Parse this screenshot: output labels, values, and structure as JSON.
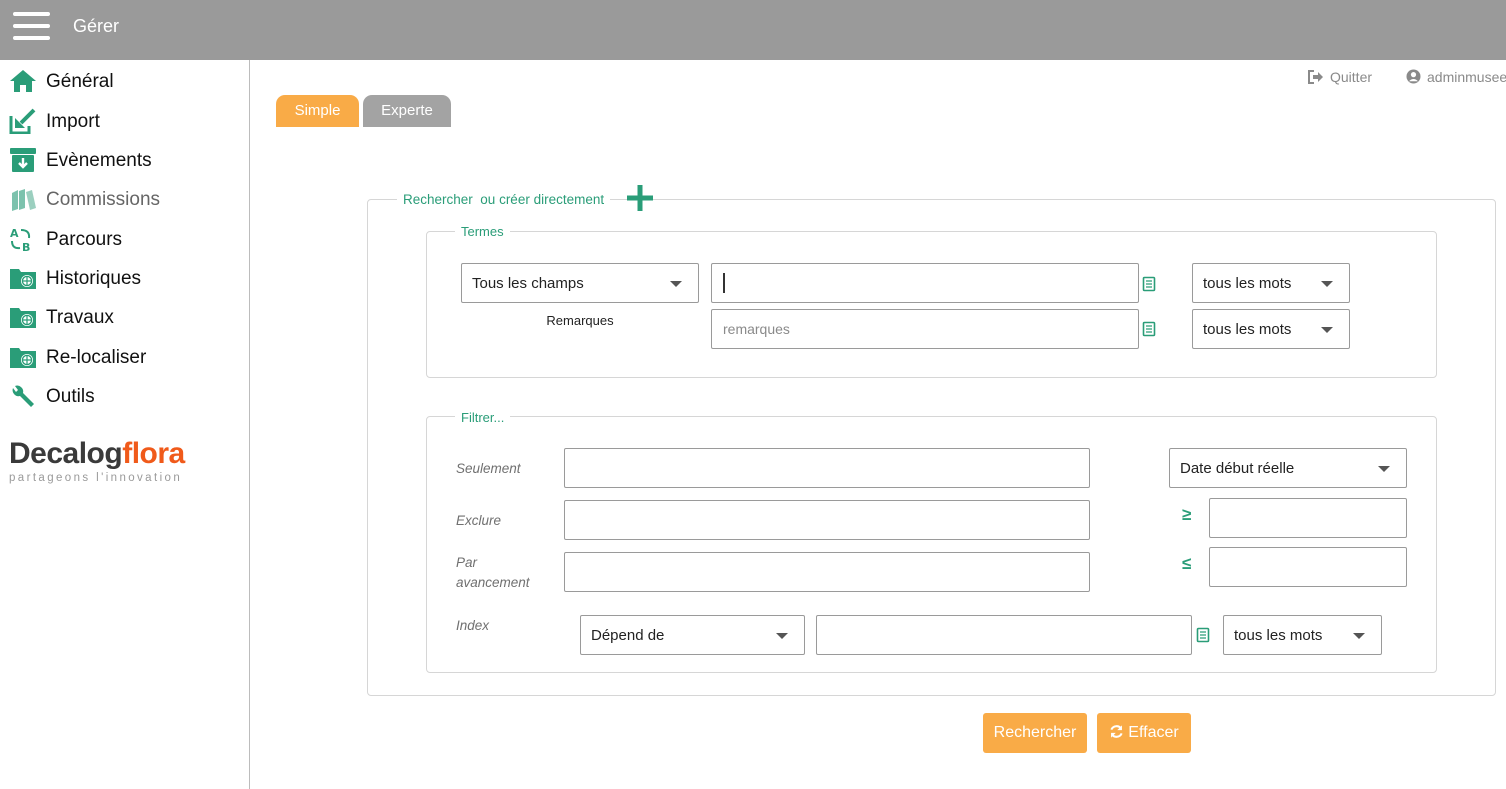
{
  "header": {
    "title": "Gérer",
    "menu_icon": "hamburger-icon"
  },
  "sidebar": {
    "items": [
      {
        "label": "Général",
        "icon": "home-icon"
      },
      {
        "label": "Import",
        "icon": "import-icon"
      },
      {
        "label": "Evènements",
        "icon": "archive-download-icon"
      },
      {
        "label": "Commissions",
        "icon": "books-icon"
      },
      {
        "label": "Parcours",
        "icon": "route-icon"
      },
      {
        "label": "Historiques",
        "icon": "folder-globe-icon"
      },
      {
        "label": "Travaux",
        "icon": "folder-globe-icon"
      },
      {
        "label": "Re-localiser",
        "icon": "folder-globe-icon"
      },
      {
        "label": "Outils",
        "icon": "wrench-icon"
      }
    ],
    "logo": {
      "part1": "Decalog",
      "part2": "flora",
      "tagline": "partageons l'innovation"
    }
  },
  "user": {
    "quit_label": "Quitter",
    "username": "adminmusee"
  },
  "tabs": [
    {
      "label": "Simple",
      "active": true
    },
    {
      "label": "Experte",
      "active": false
    }
  ],
  "search": {
    "legend_a": "Rechercher",
    "legend_b": "ou créer directement",
    "termes": {
      "legend": "Termes",
      "field_select": "Tous les champs",
      "field_caption": "Remarques",
      "term_value": "",
      "remarques_placeholder": "remarques",
      "mode1": "tous les mots",
      "mode2": "tous les mots"
    },
    "filtrer": {
      "legend": "Filtrer...",
      "seulement": "Seulement",
      "exclure": "Exclure",
      "par_avancement": "Par avancement",
      "index_label": "Index",
      "date_select": "Date début réelle",
      "gte": "≥",
      "lte": "≤",
      "index_select": "Dépend de",
      "index_mode": "tous les mots"
    },
    "buttons": {
      "search": "Rechercher",
      "clear": "Effacer"
    }
  },
  "colors": {
    "accent": "#f9ab47",
    "teal": "#2a9d78",
    "header": "#9a9a9a"
  }
}
